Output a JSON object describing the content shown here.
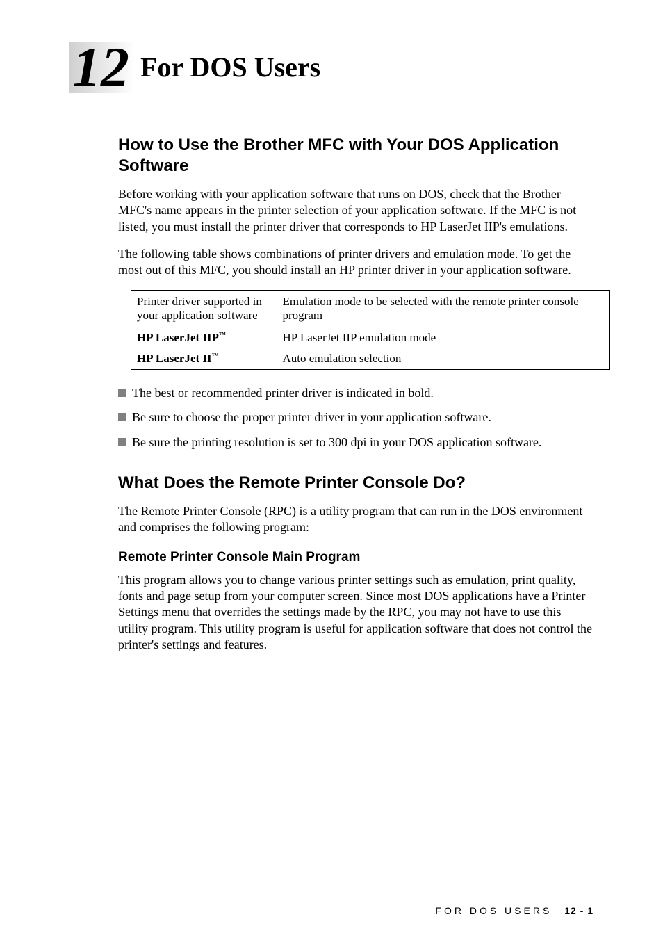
{
  "chapter": {
    "number": "12",
    "title": "For DOS Users"
  },
  "section1": {
    "heading": "How to Use the Brother MFC with Your DOS Application Software",
    "para1": "Before working with your application software that runs on DOS, check that the Brother MFC's name appears in the printer selection of your application software. If the MFC is not listed, you must install the printer driver that corresponds to HP LaserJet IIP's emulations.",
    "para2": "The following table shows combinations of printer drivers and emulation mode. To get the most out of this MFC, you should install an HP printer driver in your application software."
  },
  "table": {
    "header": {
      "col1": "Printer driver supported in your application software",
      "col2": "Emulation mode to be selected with the remote printer console program"
    },
    "row1": {
      "col1_prefix": "HP LaserJet IIP",
      "col1_tm": "™",
      "col2": "HP LaserJet IIP emulation mode"
    },
    "row2": {
      "col1_prefix": "HP LaserJet II",
      "col1_tm": "™",
      "col2": "Auto emulation selection"
    }
  },
  "bullets": {
    "b1": "The best or recommended printer driver is indicated in bold.",
    "b2": "Be sure to choose the proper printer driver in your application software.",
    "b3": "Be sure the printing resolution is set to 300 dpi in your DOS application software."
  },
  "section2": {
    "heading": "What Does the Remote Printer Console Do?",
    "para1": "The Remote Printer Console (RPC) is a utility program that can run in the DOS environment and comprises the following program:"
  },
  "subsection": {
    "heading": "Remote Printer Console Main Program",
    "para1": "This program allows you to change various printer settings such as emulation, print quality, fonts and page setup from your computer screen. Since most DOS applications have a Printer Settings menu that overrides the settings made by the RPC, you may not have to use this utility program. This utility program is useful for application software that does not control the printer's settings and features."
  },
  "footer": {
    "text": "FOR DOS USERS",
    "page": "12 - 1"
  }
}
